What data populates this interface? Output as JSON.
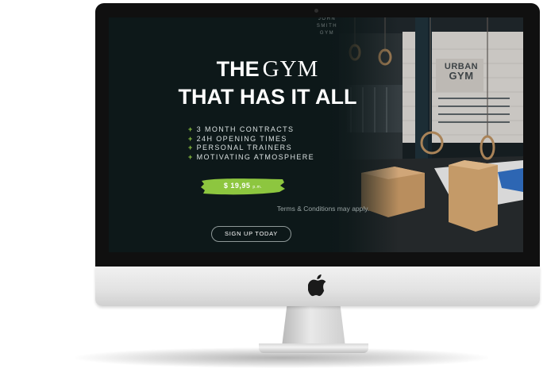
{
  "screen": {
    "logo": {
      "line1": "JOHN SMITH",
      "line2": "GYM"
    },
    "headline": {
      "the": "THE",
      "gym": "GYM",
      "line2": "THAT HAS IT ALL"
    },
    "features": [
      "3 MONTH CONTRACTS",
      "24H OPENING TIMES",
      "PERSONAL TRAINERS",
      "MOTIVATING ATMOSPHERE"
    ],
    "feature_bullet": "+",
    "price": {
      "amount": "$ 19,95",
      "unit": "p.m."
    },
    "terms": "Terms & Conditions may apply.",
    "signup_label": "SIGN UP TODAY",
    "wall_sign": {
      "line1": "URBAN",
      "line2": "GYM"
    }
  },
  "colors": {
    "accent": "#8dc63f",
    "screen_bg": "#0d1819",
    "bezel": "#101010"
  },
  "icons": [
    "apple-logo-icon"
  ]
}
